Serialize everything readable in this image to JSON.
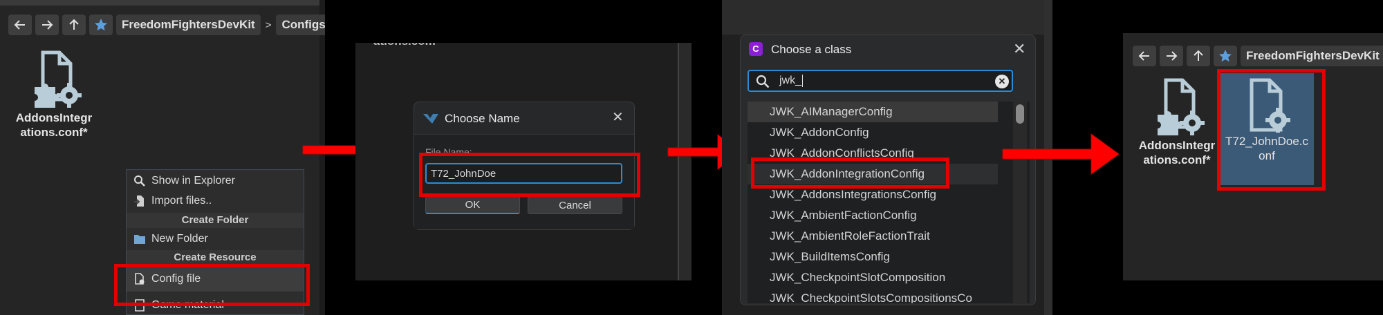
{
  "panel1": {
    "toolbar": {
      "back_icon": "arrow-left-icon",
      "forward_icon": "arrow-right-icon",
      "up_icon": "arrow-up-icon",
      "favorite_icon": "star-icon",
      "breadcrumb": [
        "FreedomFightersDevKit",
        "Configs"
      ],
      "separator": ">"
    },
    "file": {
      "name": "AddonsIntegr\nations.conf*",
      "icon": "config-file-icon"
    },
    "context_menu": {
      "items": [
        {
          "label": "Show in Explorer",
          "icon": "search-icon"
        },
        {
          "label": "Import files..",
          "icon": "import-icon"
        }
      ],
      "create_folder_header": "Create Folder",
      "new_folder": {
        "label": "New Folder",
        "icon": "folder-icon"
      },
      "create_resource_header": "Create Resource",
      "config_file": {
        "label": "Config file",
        "icon": "config-file-icon"
      },
      "game_material": {
        "label": "Game material",
        "icon": "material-icon"
      }
    }
  },
  "panel2": {
    "bg_text": "ations.com",
    "dialog": {
      "title": "Choose Name",
      "icon": "workbench-logo-icon",
      "close": "✕",
      "field_label": "File Name:",
      "value": "T72_JohnDoe",
      "ok": "OK",
      "cancel": "Cancel"
    }
  },
  "panel3": {
    "dialog": {
      "title": "Choose a class",
      "icon": "class-c-icon",
      "close": "✕",
      "search_value": "jwk_",
      "search_icon": "search-icon",
      "clear_icon": "clear-icon",
      "items": [
        "JWK_AIManagerConfig",
        "JWK_AddonConfig",
        "JWK_AddonConflictsConfig",
        "JWK_AddonIntegrationConfig",
        "JWK_AddonsIntegrationsConfig",
        "JWK_AmbientFactionConfig",
        "JWK_AmbientRoleFactionTrait",
        "JWK_BuildItemsConfig",
        "JWK_CheckpointSlotComposition",
        "JWK_CheckpointSlotsCompositionsCo"
      ]
    }
  },
  "panel4": {
    "toolbar": {
      "back_icon": "arrow-left-icon",
      "forward_icon": "arrow-right-icon",
      "up_icon": "arrow-up-icon",
      "favorite_icon": "star-icon",
      "breadcrumb": "FreedomFightersDevKit"
    },
    "files": [
      {
        "name": "AddonsIntegr\nations.conf*",
        "icon": "config-file-icon"
      },
      {
        "name": "T72_JohnDoe.c\nonf",
        "icon": "config-file-icon"
      }
    ]
  },
  "colors": {
    "highlight": "#e30000",
    "accent_blue": "#2a8cd8",
    "selected_tile": "#3a5a78",
    "star": "#5aa0e0"
  }
}
